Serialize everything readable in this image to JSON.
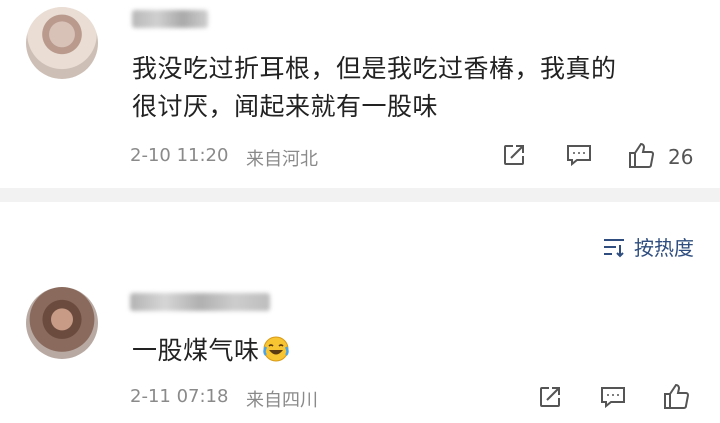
{
  "comments": [
    {
      "text_line1": "我没吃过折耳根，但是我吃过香椿，我真的",
      "text_line2": "很讨厌，闻起来就有一股味",
      "time": "2-10 11:20",
      "location": "来自河北",
      "like_count": "26"
    },
    {
      "text": "一股煤气味",
      "emoji": "laugh-cry-emoji",
      "time": "2-11 07:18",
      "location": "来自四川",
      "like_count": ""
    }
  ],
  "sort": {
    "label": "按热度",
    "icon": "sort-lines-icon"
  },
  "colors": {
    "accent": "#2f4e7f",
    "meta_text": "#8a8a8a",
    "divider": "#f2f2f2"
  },
  "icons": {
    "share": "share-icon",
    "comment": "comment-icon",
    "like": "like-thumb-icon"
  }
}
